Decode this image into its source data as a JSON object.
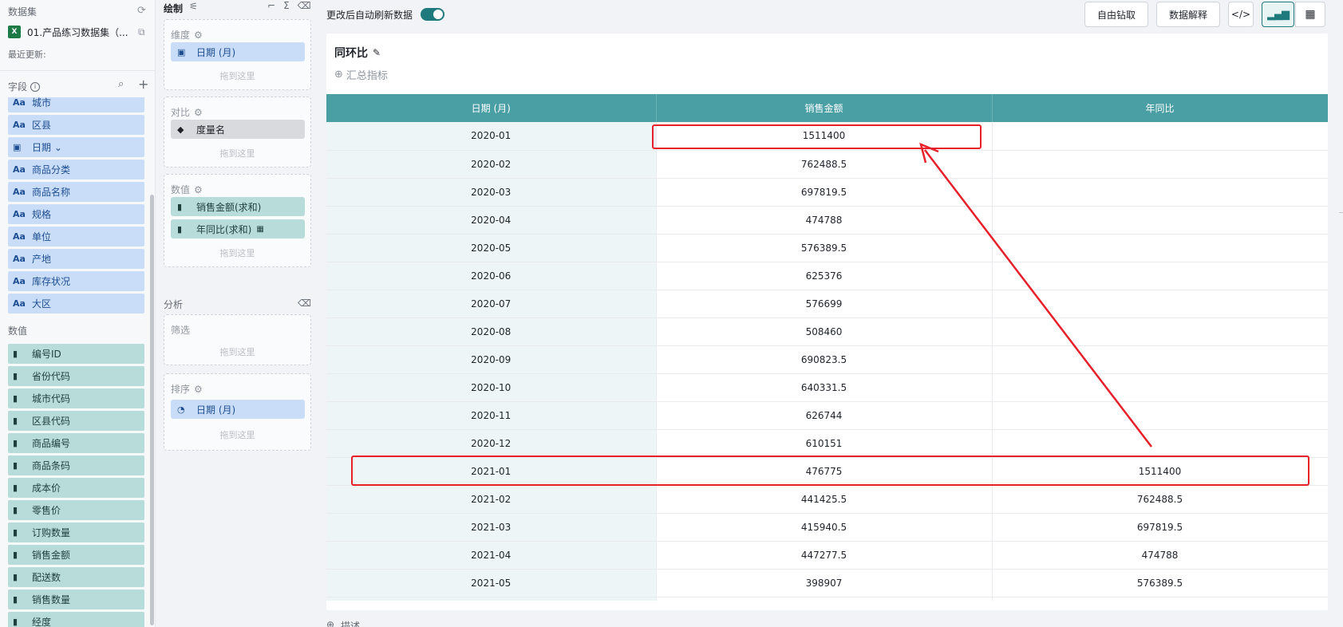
{
  "left": {
    "title": "数据集",
    "dataset_name": "01.产品练习数据集（...",
    "updated": "最近更新:",
    "fields_title": "字段",
    "dim_fields": [
      {
        "name": "城市",
        "type": "Aa"
      },
      {
        "name": "区县",
        "type": "Aa"
      },
      {
        "name": "日期 ⌄",
        "type": "date"
      },
      {
        "name": "商品分类",
        "type": "Aa"
      },
      {
        "name": "商品名称",
        "type": "Aa"
      },
      {
        "name": "规格",
        "type": "Aa"
      },
      {
        "name": "单位",
        "type": "Aa"
      },
      {
        "name": "产地",
        "type": "Aa"
      },
      {
        "name": "库存状况",
        "type": "Aa"
      },
      {
        "name": "大区",
        "type": "Aa"
      }
    ],
    "num_title": "数值",
    "num_fields": [
      "编号ID",
      "省份代码",
      "城市代码",
      "区县代码",
      "商品编号",
      "商品条码",
      "成本价",
      "零售价",
      "订购数量",
      "销售金额",
      "配送数",
      "销售数量",
      "经度"
    ]
  },
  "mid": {
    "title": "绘制",
    "dimension_title": "维度",
    "dimension_chip": "日期 (月)",
    "compare_title": "对比",
    "compare_chip": "度量名",
    "values_title": "数值",
    "value_chip_1": "销售金额(求和)",
    "value_chip_2": "年同比(求和)",
    "drop_hint": "拖到这里",
    "analysis_title": "分析",
    "filter_title": "筛选",
    "sort_title": "排序",
    "sort_chip": "日期 (月)"
  },
  "topbar": {
    "auto_refresh": "更改后自动刷新数据",
    "drill_button": "自由钻取",
    "explain_button": "数据解释",
    "code_button": "</>"
  },
  "card": {
    "title": "同环比",
    "summary": "汇总指标",
    "description": "描述"
  },
  "table": {
    "headers": [
      "日期 (月)",
      "销售金额",
      "年同比"
    ],
    "rows": [
      [
        "2020-01",
        "1511400",
        ""
      ],
      [
        "2020-02",
        "762488.5",
        ""
      ],
      [
        "2020-03",
        "697819.5",
        ""
      ],
      [
        "2020-04",
        "474788",
        ""
      ],
      [
        "2020-05",
        "576389.5",
        ""
      ],
      [
        "2020-06",
        "625376",
        ""
      ],
      [
        "2020-07",
        "576699",
        ""
      ],
      [
        "2020-08",
        "508460",
        ""
      ],
      [
        "2020-09",
        "690823.5",
        ""
      ],
      [
        "2020-10",
        "640331.5",
        ""
      ],
      [
        "2020-11",
        "626744",
        ""
      ],
      [
        "2020-12",
        "610151",
        ""
      ],
      [
        "2021-01",
        "476775",
        "1511400"
      ],
      [
        "2021-02",
        "441425.5",
        "762488.5"
      ],
      [
        "2021-03",
        "415940.5",
        "697819.5"
      ],
      [
        "2021-04",
        "447277.5",
        "474788"
      ],
      [
        "2021-05",
        "398907",
        "576389.5"
      ],
      [
        "",
        "",
        ""
      ]
    ]
  },
  "colors": {
    "header_bg": "#4a9fa5",
    "accent": "#1e7a7c",
    "annotation": "#e8202a"
  }
}
